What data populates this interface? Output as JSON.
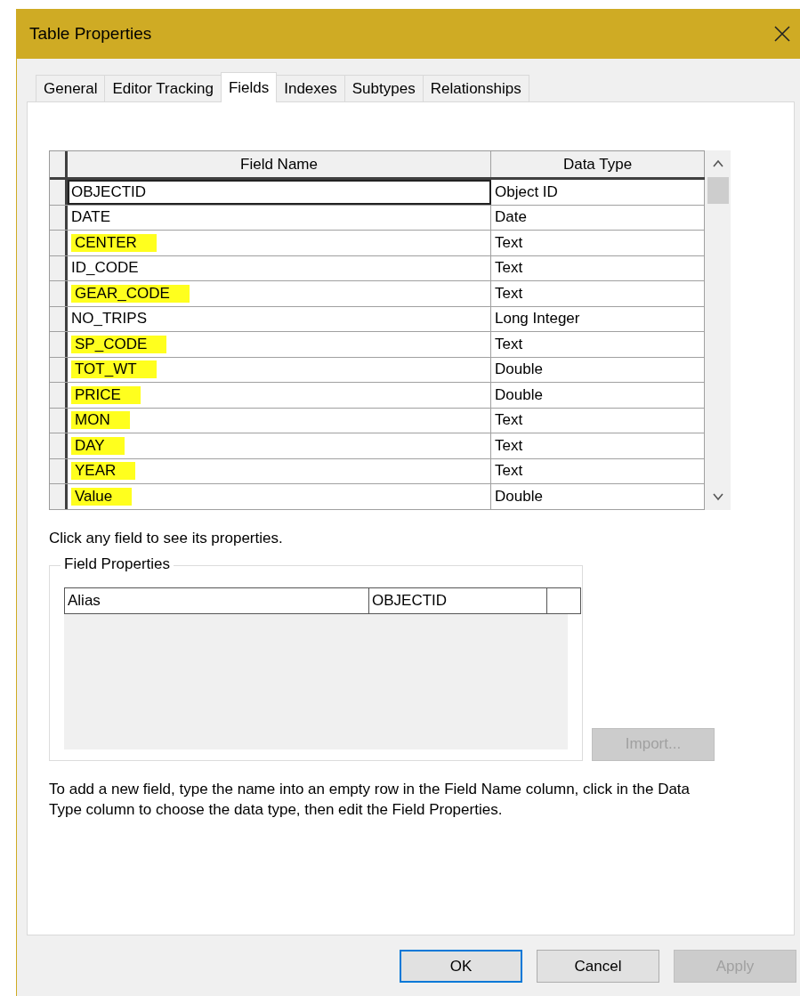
{
  "window": {
    "title": "Table Properties"
  },
  "tabs": [
    {
      "label": "General",
      "selected": false
    },
    {
      "label": "Editor Tracking",
      "selected": false
    },
    {
      "label": "Fields",
      "selected": true
    },
    {
      "label": "Indexes",
      "selected": false
    },
    {
      "label": "Subtypes",
      "selected": false
    },
    {
      "label": "Relationships",
      "selected": false
    }
  ],
  "fields_table": {
    "columns": [
      "Field Name",
      "Data Type"
    ],
    "rows": [
      {
        "field_name": "OBJECTID",
        "data_type": "Object ID",
        "selected": true,
        "highlighted": false
      },
      {
        "field_name": "DATE",
        "data_type": "Date",
        "selected": false,
        "highlighted": false
      },
      {
        "field_name": "CENTER",
        "data_type": "Text",
        "selected": false,
        "highlighted": true
      },
      {
        "field_name": "ID_CODE",
        "data_type": "Text",
        "selected": false,
        "highlighted": false
      },
      {
        "field_name": "GEAR_CODE",
        "data_type": "Text",
        "selected": false,
        "highlighted": true
      },
      {
        "field_name": "NO_TRIPS",
        "data_type": "Long Integer",
        "selected": false,
        "highlighted": false
      },
      {
        "field_name": "SP_CODE",
        "data_type": "Text",
        "selected": false,
        "highlighted": true
      },
      {
        "field_name": "TOT_WT",
        "data_type": "Double",
        "selected": false,
        "highlighted": true
      },
      {
        "field_name": "PRICE",
        "data_type": "Double",
        "selected": false,
        "highlighted": true
      },
      {
        "field_name": "MON",
        "data_type": "Text",
        "selected": false,
        "highlighted": true
      },
      {
        "field_name": "DAY",
        "data_type": "Text",
        "selected": false,
        "highlighted": true
      },
      {
        "field_name": "YEAR",
        "data_type": "Text",
        "selected": false,
        "highlighted": true
      },
      {
        "field_name": "Value",
        "data_type": "Double",
        "selected": false,
        "highlighted": true
      }
    ]
  },
  "hint": "Click any field to see its properties.",
  "field_properties": {
    "title": "Field Properties",
    "rows": [
      {
        "property": "Alias",
        "value": "OBJECTID"
      }
    ]
  },
  "import_button": {
    "label": "Import...",
    "disabled": true
  },
  "instructions": "To add a new field, type the name into an empty row in the Field Name column, click in the Data Type column to choose the data type, then edit the Field Properties.",
  "buttons": [
    {
      "label": "OK",
      "default": true,
      "disabled": false
    },
    {
      "label": "Cancel",
      "default": false,
      "disabled": false
    },
    {
      "label": "Apply",
      "default": false,
      "disabled": true
    }
  ]
}
